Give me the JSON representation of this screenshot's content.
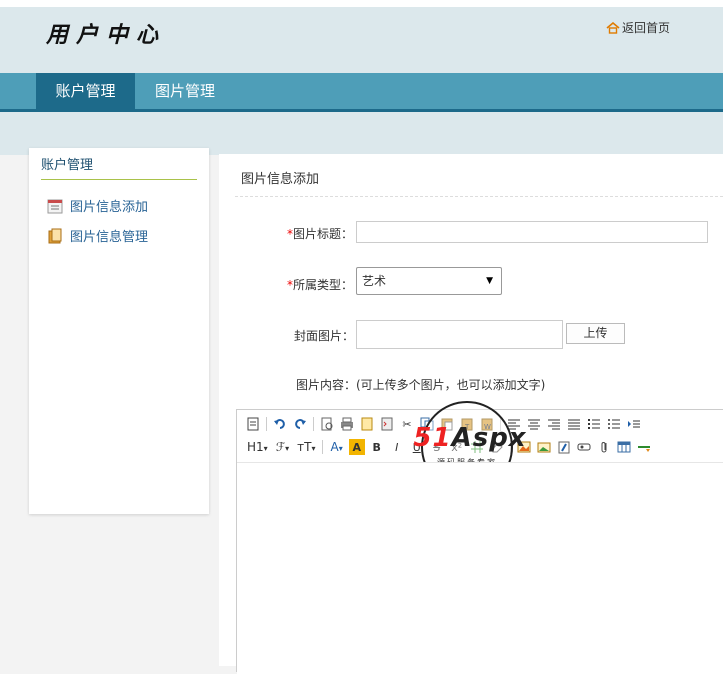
{
  "header": {
    "logo": "用户中心",
    "home_link": "返回首页"
  },
  "nav": {
    "items": [
      "账户管理",
      "图片管理"
    ]
  },
  "sidebar": {
    "title": "账户管理",
    "items": [
      "图片信息添加",
      "图片信息管理"
    ]
  },
  "main": {
    "title": "图片信息添加",
    "form": {
      "title_label": "图片标题：",
      "type_label": "所属类型：",
      "type_value": "艺术",
      "cover_label": "封面图片：",
      "upload_label": "上传",
      "content_label": "图片内容：(可上传多个图片，也可以添加文字)"
    },
    "required_mark": "*"
  },
  "editor": {
    "h1": "H1",
    "font": "ℱ",
    "size": "ᴛT",
    "color": "A"
  },
  "watermark": {
    "brand_51": "51",
    "brand_rest": "Aspx",
    "subtitle": "源码服务专家"
  },
  "colors": {
    "nav": "#4e9eb8",
    "nav_active": "#1d6a8a",
    "header_bg": "#dce8ec"
  }
}
